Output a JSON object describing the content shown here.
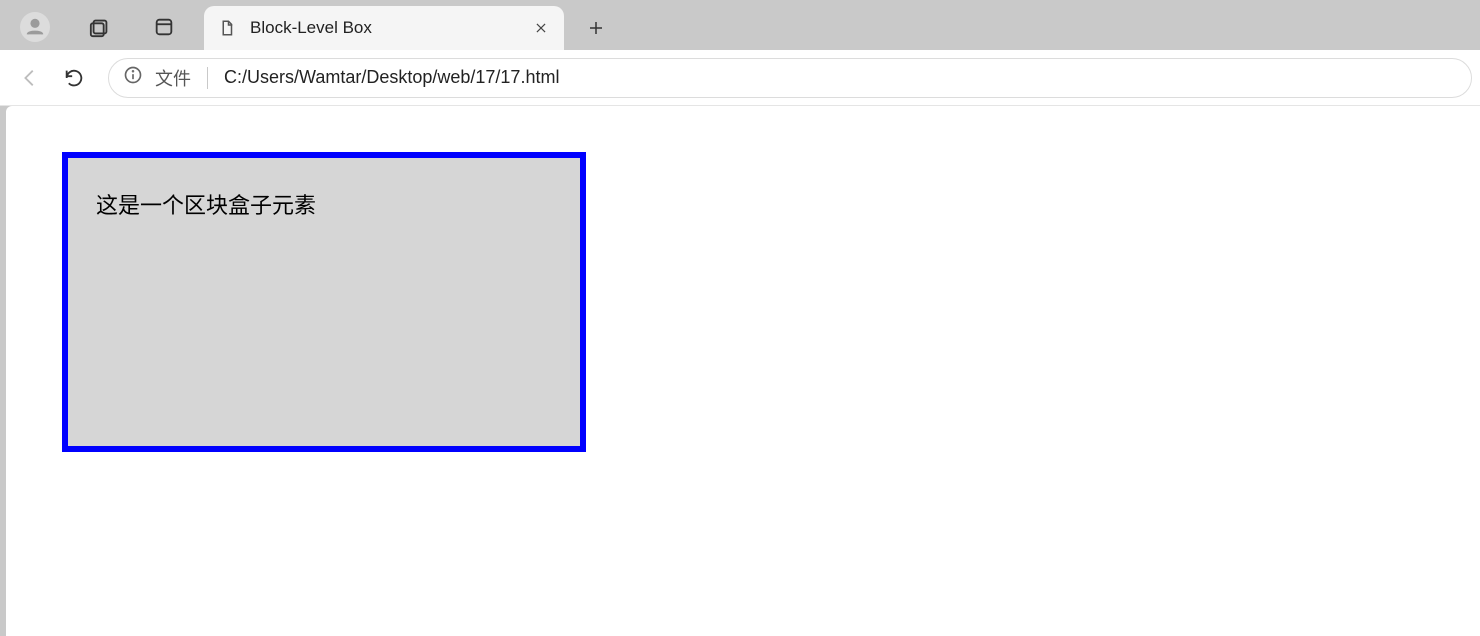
{
  "titlebar": {
    "profile_icon": "profile",
    "collections_icon": "collections",
    "tabactions_icon": "tab-actions"
  },
  "tab": {
    "title": "Block-Level Box"
  },
  "addressbar": {
    "scheme_label": "文件",
    "path": "C:/Users/Wamtar/Desktop/web/17/17.html"
  },
  "page": {
    "block_text": "这是一个区块盒子元素",
    "colors": {
      "border": "#0000ff",
      "bg": "#d6d6d6"
    }
  }
}
